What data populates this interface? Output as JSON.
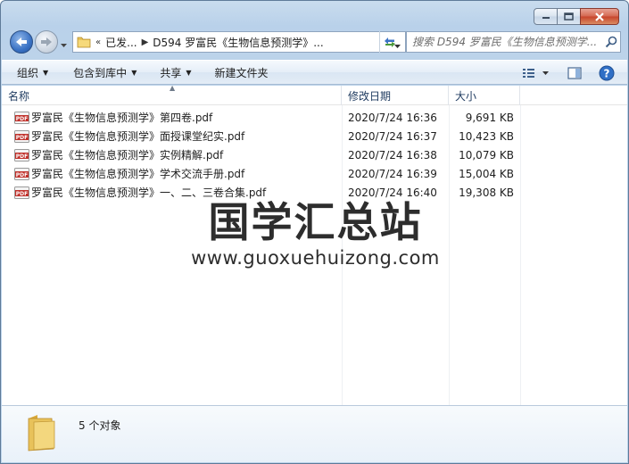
{
  "window": {
    "address": {
      "overflow_marker": "«",
      "crumb_1": "已发...",
      "crumb_2": "D594 罗富民《生物信息预测学》..."
    },
    "search": {
      "placeholder": "搜索 D594 罗富民《生物信息预测学..."
    }
  },
  "toolbar": {
    "organize": "组织",
    "include_in_library": "包含到库中",
    "share": "共享",
    "new_folder": "新建文件夹"
  },
  "columns": {
    "name": "名称",
    "date": "修改日期",
    "size": "大小"
  },
  "files": [
    {
      "name": "罗富民《生物信息预测学》第四卷.pdf",
      "date": "2020/7/24 16:36",
      "size": "9,691 KB"
    },
    {
      "name": "罗富民《生物信息预测学》面授课堂纪实.pdf",
      "date": "2020/7/24 16:37",
      "size": "10,423 KB"
    },
    {
      "name": "罗富民《生物信息预测学》实例精解.pdf",
      "date": "2020/7/24 16:38",
      "size": "10,079 KB"
    },
    {
      "name": "罗富民《生物信息预测学》学术交流手册.pdf",
      "date": "2020/7/24 16:39",
      "size": "15,004 KB"
    },
    {
      "name": "罗富民《生物信息预测学》一、二、三卷合集.pdf",
      "date": "2020/7/24 16:40",
      "size": "19,308 KB"
    }
  ],
  "watermark": {
    "title": "国学汇总站",
    "url": "www.guoxuehuizong.com"
  },
  "status": {
    "item_count": "5 个对象"
  },
  "icons": {
    "back": "back-arrow-icon",
    "forward": "forward-arrow-icon",
    "folder": "folder-icon",
    "refresh": "refresh-icon",
    "search": "search-icon",
    "pdf": "pdf-file-icon",
    "views": "view-options-icon",
    "preview": "preview-pane-icon",
    "help": "help-icon"
  },
  "colors": {
    "chrome": "#bcd3ea",
    "accent": "#3a72c4",
    "close": "#c7432a",
    "pdf": "#c0302a"
  }
}
